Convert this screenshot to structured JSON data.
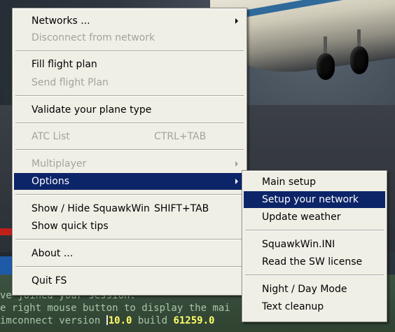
{
  "main_menu": {
    "items": [
      {
        "label": "Networks ...",
        "has_submenu": true,
        "enabled": true
      },
      {
        "label": "Disconnect from network",
        "enabled": false
      },
      {
        "label": "Fill flight plan",
        "enabled": true
      },
      {
        "label": "Send flight Plan",
        "enabled": false
      },
      {
        "label": "Validate your plane type",
        "enabled": true
      },
      {
        "label": "ATC List",
        "shortcut": "CTRL+TAB",
        "enabled": false
      },
      {
        "label": "Multiplayer",
        "has_submenu": true,
        "enabled": false
      },
      {
        "label": "Options",
        "has_submenu": true,
        "enabled": true,
        "selected": true
      },
      {
        "label": "Show / Hide SquawkWin",
        "shortcut": "SHIFT+TAB",
        "enabled": true
      },
      {
        "label": "Show quick tips",
        "enabled": true
      },
      {
        "label": "About ...",
        "enabled": true
      },
      {
        "label": "Quit FS",
        "enabled": true
      }
    ]
  },
  "options_submenu": {
    "items": [
      {
        "label": "Main setup"
      },
      {
        "label": "Setup your network",
        "selected": true
      },
      {
        "label": "Update weather"
      },
      {
        "label": "SquawkWin.INI"
      },
      {
        "label": "Read the SW license"
      },
      {
        "label": "Night / Day Mode"
      },
      {
        "label": "Text cleanup"
      }
    ]
  },
  "chat": {
    "line1": "ve joined your session.",
    "line2": "e right mouse button to display the mai",
    "line3_prefix": "imconnect version ",
    "version": "10.0",
    "line3_mid": " build ",
    "build": "61259.0"
  },
  "colors": {
    "menu_bg": "#f0efe6",
    "highlight": "#0c2468",
    "disabled_text": "#a4a39b",
    "chat_text": "#a9c6a9",
    "chat_highlight": "#ffff66"
  }
}
